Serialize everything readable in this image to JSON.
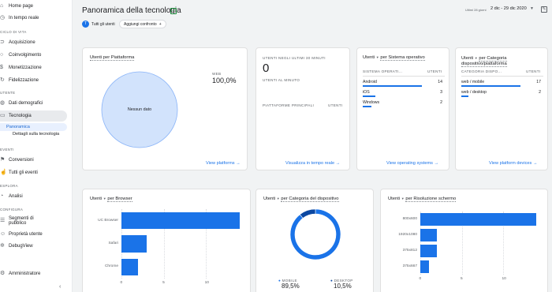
{
  "sidebar": {
    "top_items": [
      {
        "label": "Home page",
        "icon": "home-icon"
      },
      {
        "label": "In tempo reale",
        "icon": "clock-icon"
      }
    ],
    "section_lifecycle": "CICLO DI VITA",
    "lifecycle_items": [
      {
        "label": "Acquisizione",
        "icon": "acquisition-icon"
      },
      {
        "label": "Coinvolgimento",
        "icon": "engagement-icon"
      },
      {
        "label": "Monetizzazione",
        "icon": "money-icon"
      },
      {
        "label": "Fidelizzazione",
        "icon": "retention-icon"
      }
    ],
    "section_user": "UTENTE",
    "user_items": [
      {
        "label": "Dati demografici",
        "icon": "globe-icon"
      },
      {
        "label": "Tecnologia",
        "icon": "devices-icon"
      }
    ],
    "tech_subitems": [
      "Panoramica",
      "Dettagli sulla tecnologia"
    ],
    "section_events": "EVENTI",
    "event_items": [
      {
        "label": "Conversioni",
        "icon": "flag-icon"
      },
      {
        "label": "Tutti gli eventi",
        "icon": "touch-icon"
      }
    ],
    "section_explore": "ESPLORA",
    "explore_items": [
      {
        "label": "Analisi",
        "icon": "analysis-icon"
      }
    ],
    "section_config": "CONFIGURA",
    "config_items": [
      {
        "label": "Segmenti di pubblico",
        "icon": "audience-icon"
      },
      {
        "label": "Proprietà utente",
        "icon": "user-prop-icon"
      },
      {
        "label": "DebugView",
        "icon": "debug-icon"
      }
    ],
    "admin_label": "Amministratore"
  },
  "header": {
    "title": "Panoramica della tecnologia",
    "date_label": "Ultimi 28 giorni",
    "date_range": "2 dic - 29 dic 2020",
    "segment_avatar": "T",
    "segment_label": "Tutti gli utenti",
    "compare_label": "Aggiungi confronto",
    "compare_plus": "+"
  },
  "cards": {
    "platform": {
      "title": "Utenti per Piattaforma",
      "legend_label": "WEB",
      "legend_value": "100,0%",
      "pie_label": "Nessun dato",
      "link": "View platforms",
      "pie_color": "#d2e3fc"
    },
    "realtime": {
      "header": "UTENTI NEGLI ULTIMI 30 MINUTI",
      "value": "0",
      "sub": "UTENTI AL MINUTO",
      "table_header": "PIATTAFORME PRINCIPALI",
      "table_col": "UTENTI",
      "link": "Visualizza in tempo reale"
    },
    "os": {
      "title_prefix": "Utenti",
      "title_dim": "per Sistema operativo",
      "col1": "SISTEMA OPERATI...",
      "col2": "UTENTI",
      "rows": [
        {
          "label": "Android",
          "value": "14",
          "share": 1.0
        },
        {
          "label": "iOS",
          "value": "3",
          "share": 0.21
        },
        {
          "label": "Windows",
          "value": "2",
          "share": 0.14
        }
      ],
      "link": "View operating systems"
    },
    "platform_device": {
      "title_prefix": "Utenti",
      "title_dim": "per Categoria dispositivo/piattaforma",
      "col1": "CATEGORIA DISPO...",
      "col2": "UTENTI",
      "rows": [
        {
          "label": "web / mobile",
          "value": "17",
          "share": 1.0
        },
        {
          "label": "web / desktop",
          "value": "2",
          "share": 0.12
        }
      ],
      "link": "View platform devices"
    },
    "browser": {
      "title_prefix": "Utenti",
      "title_dim": "per Browser"
    },
    "device_cat": {
      "title_prefix": "Utenti",
      "title_dim": "per Categoria del dispositivo",
      "legend": [
        {
          "label": "MOBILE",
          "value": "89,5%"
        },
        {
          "label": "DESKTOP",
          "value": "10,5%"
        }
      ]
    },
    "resolution": {
      "title_prefix": "Utenti",
      "title_dim": "per Risoluzione schermo"
    }
  },
  "chart_data": [
    {
      "type": "bar",
      "orientation": "horizontal",
      "categories": [
        "UC Browser",
        "Safari",
        "Chrome"
      ],
      "values": [
        14,
        3,
        2
      ],
      "xlim": [
        0,
        14
      ],
      "xticks": [
        "0",
        "5",
        "10"
      ],
      "color": "#1a73e8"
    },
    {
      "type": "pie",
      "donut": true,
      "categories": [
        "MOBILE",
        "DESKTOP"
      ],
      "values": [
        89.5,
        10.5
      ],
      "colors": [
        "#1a73e8",
        "#0b47a1"
      ]
    },
    {
      "type": "bar",
      "orientation": "horizontal",
      "categories": [
        "800x600",
        "1920x1080",
        "375x812",
        "375x667"
      ],
      "values": [
        14,
        2,
        2,
        1
      ],
      "xlim": [
        0,
        14
      ],
      "xticks": [
        "0",
        "5",
        "10"
      ],
      "color": "#1a73e8"
    }
  ]
}
